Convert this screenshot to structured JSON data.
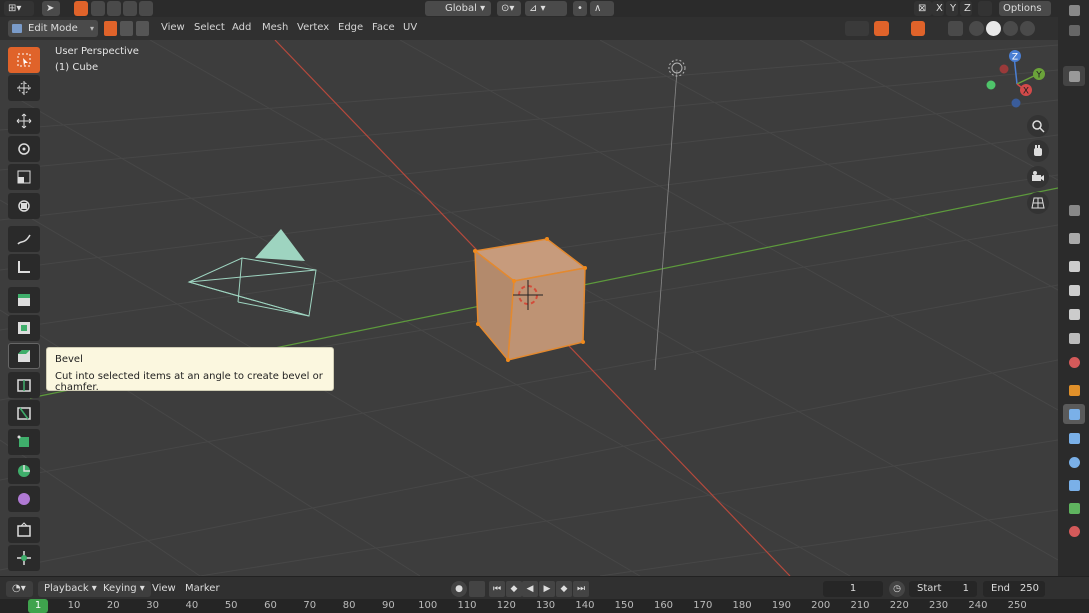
{
  "top_bar": {
    "orientation": "Global",
    "options": "Options",
    "axes": [
      "X",
      "Y",
      "Z"
    ]
  },
  "header": {
    "mode": "Edit Mode",
    "menus": [
      "View",
      "Select",
      "Add",
      "Mesh",
      "Vertex",
      "Edge",
      "Face",
      "UV"
    ]
  },
  "viewport": {
    "perspective": "User Perspective",
    "object": "(1) Cube"
  },
  "tooltip": {
    "title": "Bevel",
    "description": "Cut into selected items at an angle to create bevel or chamfer."
  },
  "gizmo": {
    "x": "X",
    "y": "Y",
    "z": "Z"
  },
  "timeline": {
    "playback": "Playback",
    "keying": "Keying",
    "view": "View",
    "marker": "Marker",
    "current_frame": "1",
    "start_label": "Start",
    "start_value": "1",
    "end_label": "End",
    "end_value": "250"
  },
  "ruler": {
    "current": "1",
    "ticks": [
      "10",
      "20",
      "30",
      "40",
      "50",
      "60",
      "70",
      "80",
      "90",
      "100",
      "110",
      "120",
      "130",
      "140",
      "150",
      "160",
      "170",
      "180",
      "190",
      "200",
      "210",
      "220",
      "230",
      "240",
      "250"
    ]
  },
  "colors": {
    "accent": "#e0632a",
    "x_axis": "#b5493c",
    "y_axis": "#5d9a3c",
    "frame_marker": "#3fa34d"
  }
}
